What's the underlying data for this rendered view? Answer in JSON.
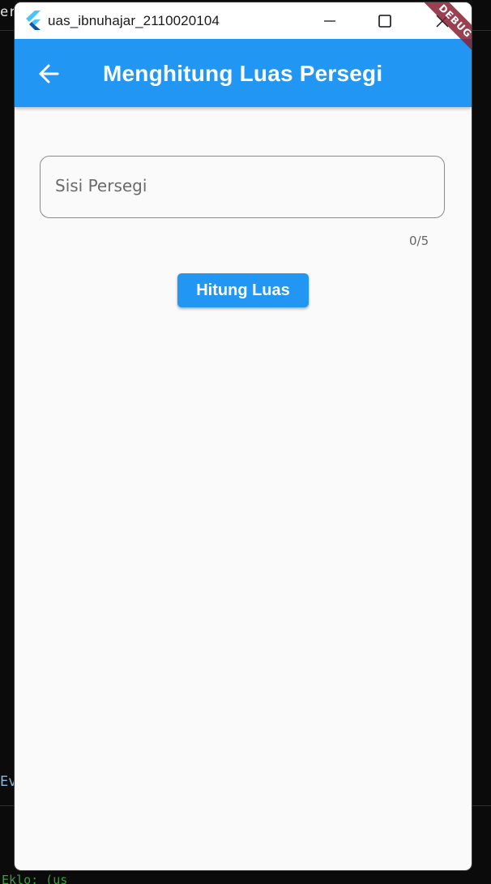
{
  "background": {
    "top_left_text": "er.",
    "mid_left_text": "Ev",
    "bottom_left_text": "Eklo: (us"
  },
  "window": {
    "title": "uas_ibnuhajar_2110020104",
    "controls": {
      "minimize": "minimize-icon",
      "maximize": "maximize-icon",
      "close": "close-icon"
    }
  },
  "appbar": {
    "title": "Menghitung Luas Persegi",
    "back_icon": "arrow-back-icon",
    "debug_banner": "DEBUG",
    "color": "#2196f3"
  },
  "form": {
    "input": {
      "placeholder": "Sisi Persegi",
      "value": "",
      "counter": "0/5"
    },
    "button_label": "Hitung Luas"
  }
}
